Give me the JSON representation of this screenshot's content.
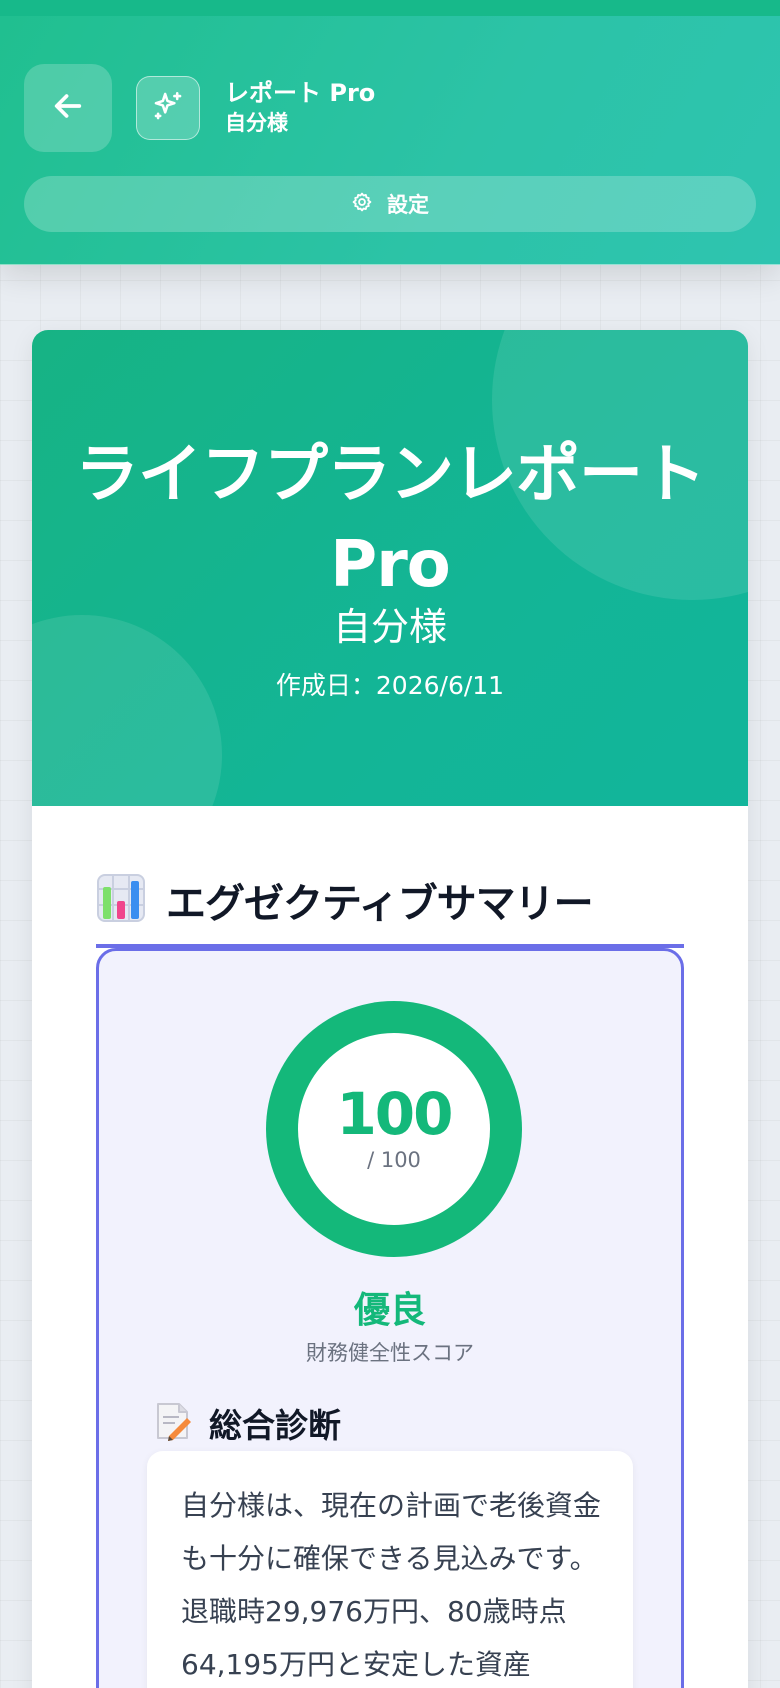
{
  "header": {
    "title": "レポート Pro",
    "subtitle": "自分様",
    "settings_label": "設定",
    "back_icon": "arrow-left-icon",
    "app_icon": "sparkles-icon",
    "settings_icon": "gear-icon"
  },
  "report": {
    "title": "ライフプランレポート Pro",
    "subtitle": "自分様",
    "date": "作成日：2026/6/11",
    "summary_section": {
      "icon": "bar-chart-icon",
      "title": "エグゼクティブサマリー",
      "score": {
        "value": "100",
        "max": "/ 100",
        "level": 1.0,
        "rating": "優良",
        "label": "財務健全性スコア"
      },
      "diagnosis": {
        "icon": "memo-icon",
        "title": "総合診断",
        "text": "自分様は、現在の計画で老後資金も十分に確保できる見込みです。退職時29,976万円、80歳時点64,195万円と安定した資産"
      }
    }
  },
  "colors": {
    "header": "#20bf8f",
    "hero": "#17b384",
    "accent": "#6b6ee8",
    "score": "#14b87a"
  }
}
